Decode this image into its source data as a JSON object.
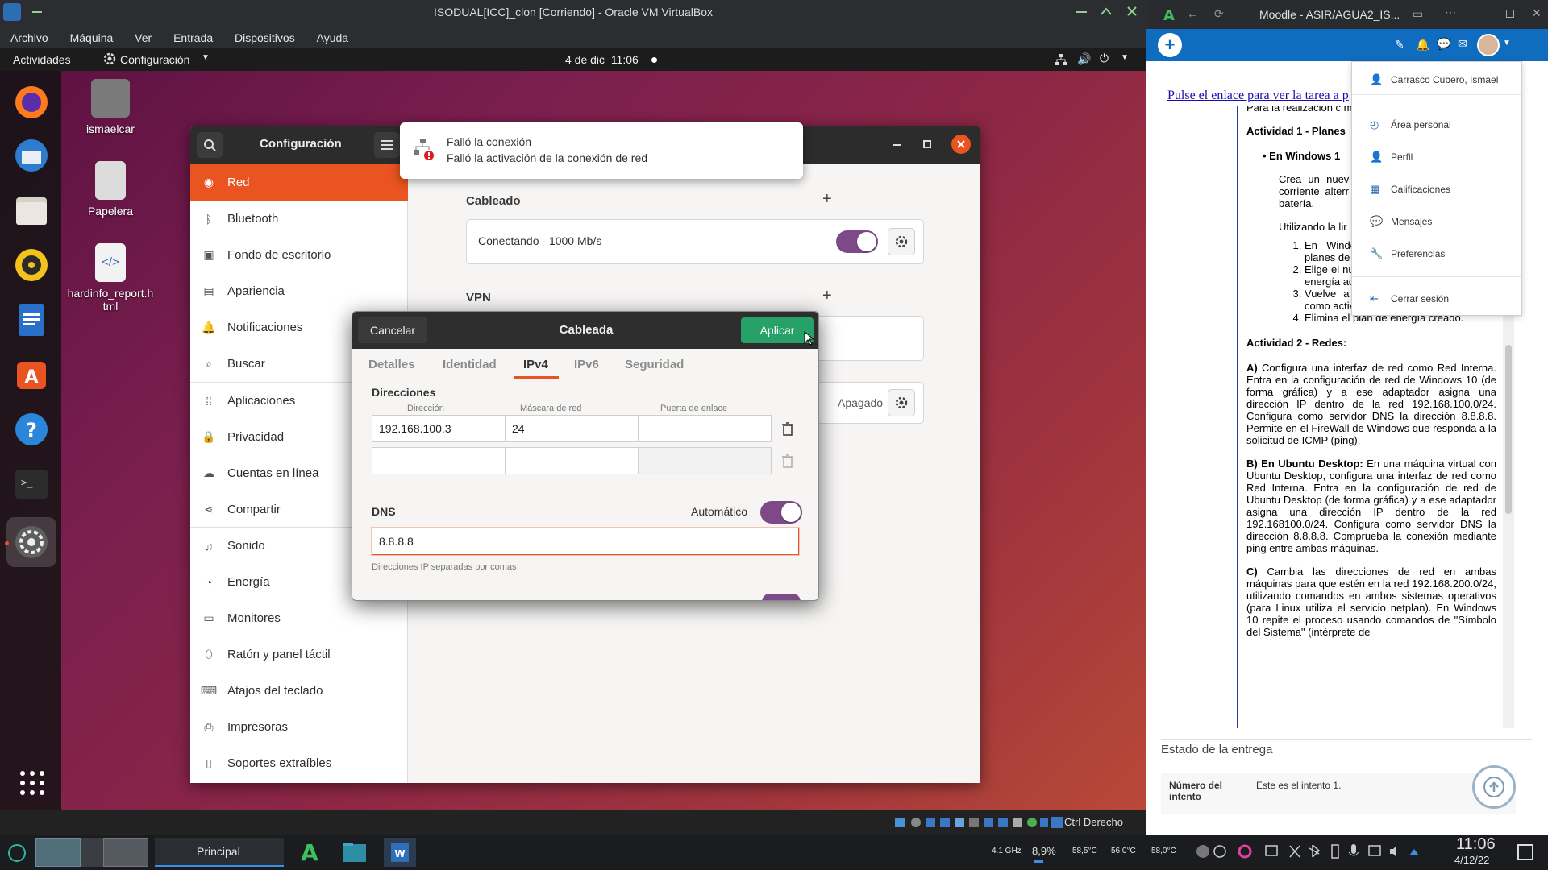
{
  "vbox": {
    "title": "ISODUAL[ICC]_clon [Corriendo] - Oracle VM VirtualBox",
    "menu": [
      "Archivo",
      "Máquina",
      "Ver",
      "Entrada",
      "Dispositivos",
      "Ayuda"
    ],
    "host_key": "Ctrl Derecho"
  },
  "ubuntu": {
    "activities": "Actividades",
    "app_menu": "Configuración",
    "clock": "4 de dic  11:06",
    "desktop_icons": [
      "ismaelcar",
      "Papelera",
      "hardinfo_report.html"
    ]
  },
  "settings": {
    "title": "Configuración",
    "sidebar": [
      {
        "label": "Red",
        "icon": "network-icon"
      },
      {
        "label": "Bluetooth",
        "icon": "bluetooth-icon"
      },
      {
        "label": "Fondo de escritorio",
        "icon": "wallpaper-icon"
      },
      {
        "label": "Apariencia",
        "icon": "appearance-icon"
      },
      {
        "label": "Notificaciones",
        "icon": "bell-icon"
      },
      {
        "label": "Buscar",
        "icon": "search-icon"
      },
      {
        "label": "Aplicaciones",
        "icon": "apps-grid-icon"
      },
      {
        "label": "Privacidad",
        "icon": "lock-icon"
      },
      {
        "label": "Cuentas en línea",
        "icon": "cloud-icon"
      },
      {
        "label": "Compartir",
        "icon": "share-icon"
      },
      {
        "label": "Sonido",
        "icon": "music-note-icon"
      },
      {
        "label": "Energía",
        "icon": "power-icon"
      },
      {
        "label": "Monitores",
        "icon": "monitor-icon"
      },
      {
        "label": "Ratón y panel táctil",
        "icon": "mouse-icon"
      },
      {
        "label": "Atajos del teclado",
        "icon": "keyboard-icon"
      },
      {
        "label": "Impresoras",
        "icon": "printer-icon"
      },
      {
        "label": "Soportes extraíbles",
        "icon": "media-icon"
      }
    ],
    "wired_title": "Cableado",
    "wired_status": "Conectando - 1000 Mb/s",
    "vpn_title": "VPN",
    "proxy_status": "Apagado"
  },
  "notification": {
    "title": "Falló la conexión",
    "body": "Falló la activación de la conexión de red"
  },
  "dialog": {
    "cancel": "Cancelar",
    "title": "Cableada",
    "apply": "Aplicar",
    "tabs": [
      "Detalles",
      "Identidad",
      "IPv4",
      "IPv6",
      "Seguridad"
    ],
    "active_tab": "IPv4",
    "addresses_title": "Direcciones",
    "col_address": "Dirección",
    "col_netmask": "Máscara de red",
    "col_gateway": "Puerta de enlace",
    "row1": {
      "address": "192.168.100.3",
      "netmask": "24",
      "gateway": ""
    },
    "dns_title": "DNS",
    "automatic": "Automático",
    "dns_value": "8.8.8.8",
    "dns_hint": "Direcciones IP separadas por comas"
  },
  "taskbar": {
    "workspace": "Principal",
    "cpu_freq": "4.1 GHz",
    "cpu_load": "8,9%",
    "temp1": "58,5°C",
    "temp2": "56,0°C",
    "temp3": "58,0°C",
    "time": "11:06",
    "date": "4/12/22"
  },
  "browser": {
    "title": "Moodle - ASIR/AGUA2_IS...",
    "link": "Pulse el enlace para ver la tarea a p",
    "user_menu": [
      {
        "label": "Carrasco Cubero, Ismael",
        "icon": "user-icon"
      },
      {
        "label": "Área personal",
        "icon": "dashboard-icon"
      },
      {
        "label": "Perfil",
        "icon": "user-icon"
      },
      {
        "label": "Calificaciones",
        "icon": "grades-icon"
      },
      {
        "label": "Mensajes",
        "icon": "chat-icon"
      },
      {
        "label": "Preferencias",
        "icon": "wrench-icon"
      },
      {
        "label": "Cerrar sesión",
        "icon": "logout-icon"
      }
    ],
    "doc": {
      "intro": "Para la realización c máquina virtual cread",
      "act1_title": "Actividad 1 - Planes",
      "act1_bullet": "En Windows 1",
      "act1_p": "Crea un nuev \"tarea1\" confi apague la pa corriente alterr trabajando cor pantalla a los batería.",
      "act1_using": "Utilizando la lir",
      "act1_list": [
        "En Windows 10, muestra todos los planes de energía.",
        "Elige el nuevo plan creado como plan de energía activo.",
        "Vuelve a elegir otro plan de energía como activo.",
        "Elimina el plan de energía creado."
      ],
      "act2_title": "Actividad 2 - Redes:",
      "act2_a_label": "A)",
      "act2_a": " Configura una interfaz de red como Red Interna. Entra en la configuración de red de Windows 10 (de forma gráfica) y a ese adaptador asigna una dirección IP dentro de la red 192.168.100.0/24. Configura como servidor DNS la dirección 8.8.8.8. Permite en el FireWall de Windows que responda a la solicitud de ICMP (ping).",
      "act2_b_label": "B) En Ubuntu Desktop:",
      "act2_b": " En una máquina virtual con Ubuntu Desktop, configura una interfaz de red como Red Interna. Entra en la configuración de red de Ubuntu Desktop (de forma gráfica) y a ese adaptador asigna una dirección IP dentro de la red 192.168100.0/24. Configura como servidor DNS la dirección 8.8.8.8. Comprueba la conexión mediante ping entre ambas máquinas.",
      "act2_c_label": "C)",
      "act2_c": " Cambia las direcciones de red en ambas máquinas para que estén en la red 192.168.200.0/24, utilizando comandos en ambos sistemas operativos (para Linux utiliza el servicio netplan). En Windows 10 repite el proceso usando comandos de \"Símbolo del Sistema\" (intérprete de"
    },
    "submission_title": "Estado de la entrega",
    "attempt_label": "Número del intento",
    "attempt_value": "Este es el intento 1."
  }
}
